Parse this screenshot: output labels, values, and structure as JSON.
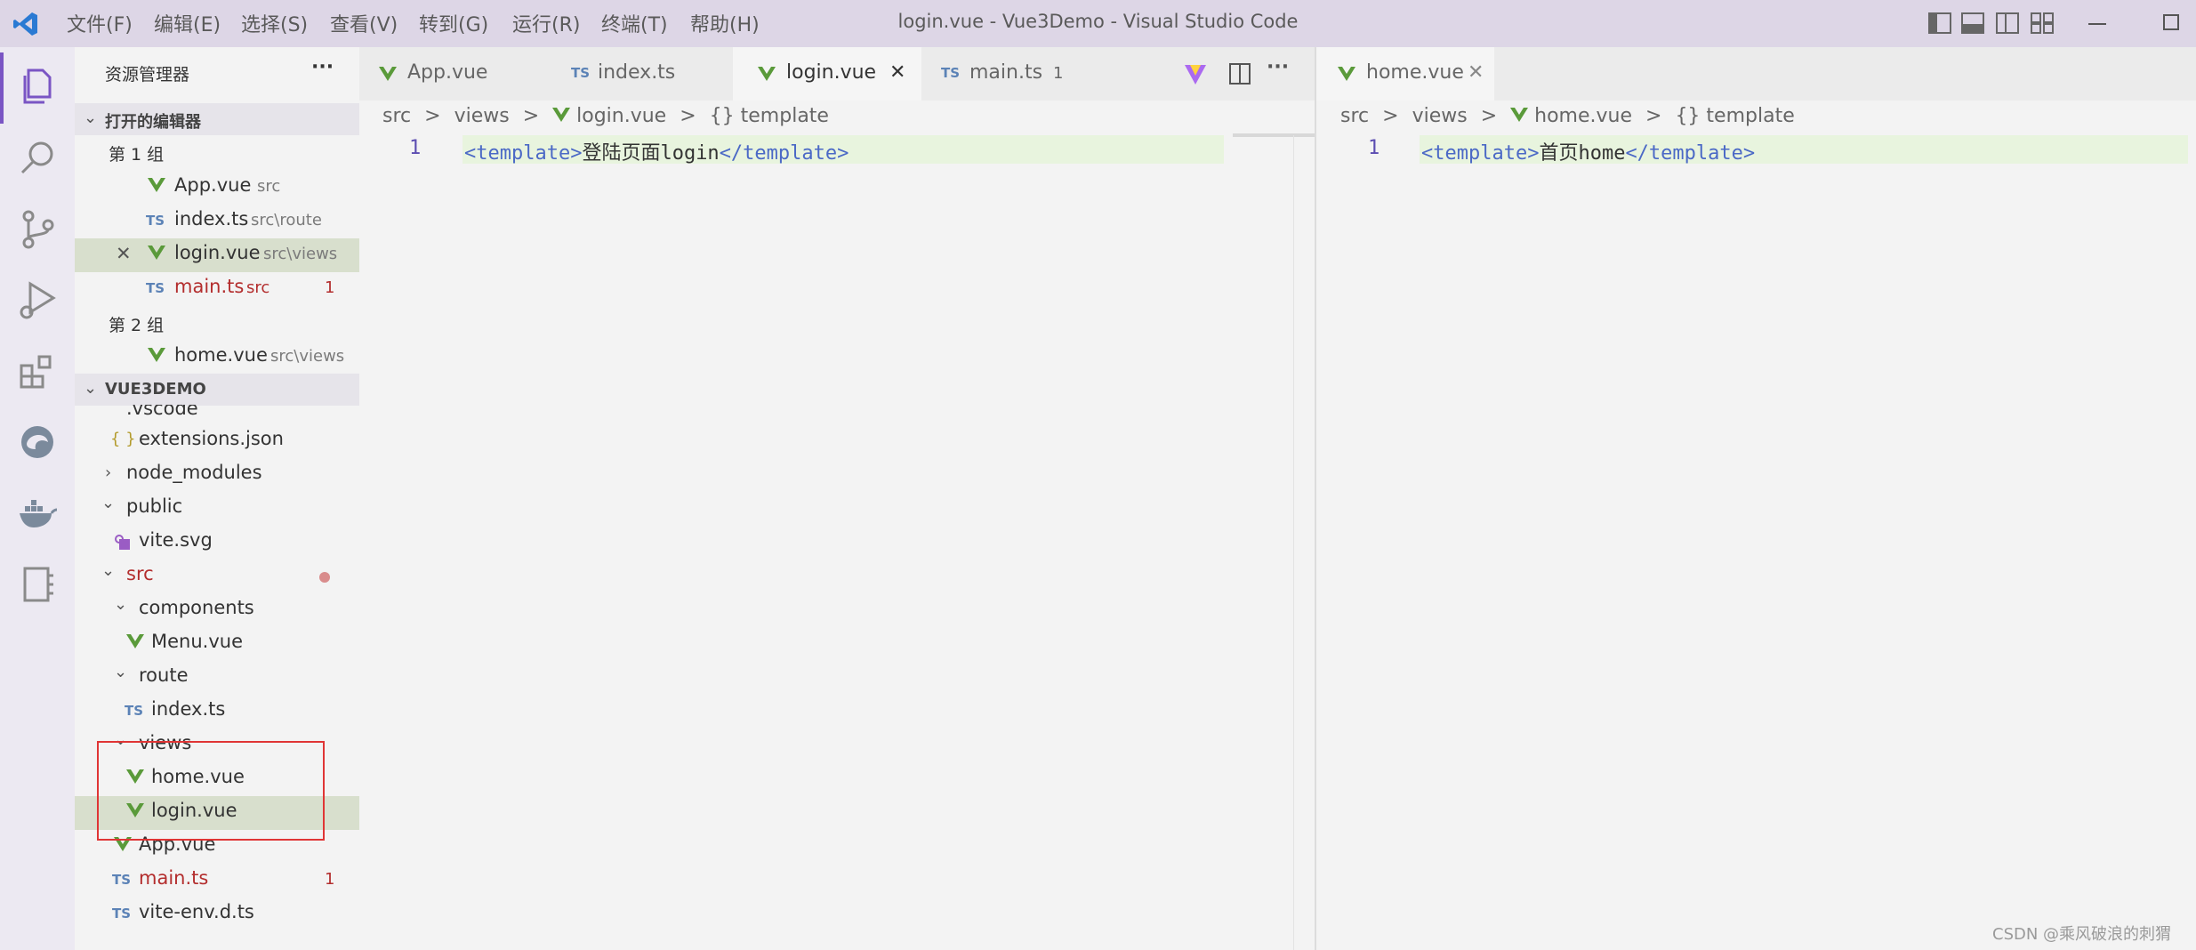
{
  "titlebar": {
    "menu": [
      "文件(F)",
      "编辑(E)",
      "选择(S)",
      "查看(V)",
      "转到(G)",
      "运行(R)",
      "终端(T)",
      "帮助(H)"
    ],
    "title": "login.vue - Vue3Demo - Visual Studio Code"
  },
  "sidebar": {
    "title": "资源管理器",
    "more": "···",
    "open_editors": {
      "header": "打开的编辑器",
      "group1": "第 1 组",
      "group2": "第 2 组",
      "items": [
        {
          "name": "App.vue",
          "path": "src"
        },
        {
          "name": "index.ts",
          "path": "src\\route"
        },
        {
          "name": "login.vue",
          "path": "src\\views"
        },
        {
          "name": "main.ts",
          "path": "src",
          "badge": "1"
        },
        {
          "name": "home.vue",
          "path": "src\\views"
        }
      ],
      "close_glyph": "✕"
    },
    "project": {
      "header": "VUE3DEMO",
      "partial": ".vscode",
      "items": {
        "extensions": "extensions.json",
        "node_modules": "node_modules",
        "public": "public",
        "vite_svg": "vite.svg",
        "src": "src",
        "components": "components",
        "menu_vue": "Menu.vue",
        "route": "route",
        "index_ts": "index.ts",
        "views": "views",
        "home_vue": "home.vue",
        "login_vue": "login.vue",
        "app_vue": "App.vue",
        "main_ts": "main.ts",
        "main_ts_badge": "1",
        "vite_env": "vite-env.d.ts"
      }
    },
    "icons": {
      "ts": "TS",
      "json": "{ }"
    }
  },
  "editor1": {
    "tabs": [
      {
        "label": "App.vue"
      },
      {
        "label": "index.ts"
      },
      {
        "label": "login.vue"
      },
      {
        "label": "main.ts",
        "badge": "1"
      }
    ],
    "close_glyph": "✕",
    "more": "···",
    "breadcrumb": [
      "src",
      "views",
      "login.vue",
      "{} template"
    ],
    "line_no": "1",
    "code": {
      "open": "<template>",
      "text": "登陆页面login",
      "close": "</template>"
    }
  },
  "editor2": {
    "tab": "home.vue",
    "close_glyph": "✕",
    "breadcrumb": [
      "src",
      "views",
      "home.vue",
      "{} template"
    ],
    "line_no": "1",
    "code": {
      "open": "<template>",
      "text": "首页home",
      "close": "</template>"
    }
  },
  "breadcrumb_sep": ">",
  "watermark": "CSDN @乘风破浪的刺猬",
  "colors": {
    "accent": "#7a55c4",
    "vue_green": "#5a9a3a",
    "ts_blue": "#5b82b6",
    "error_red": "#b32d2d"
  }
}
